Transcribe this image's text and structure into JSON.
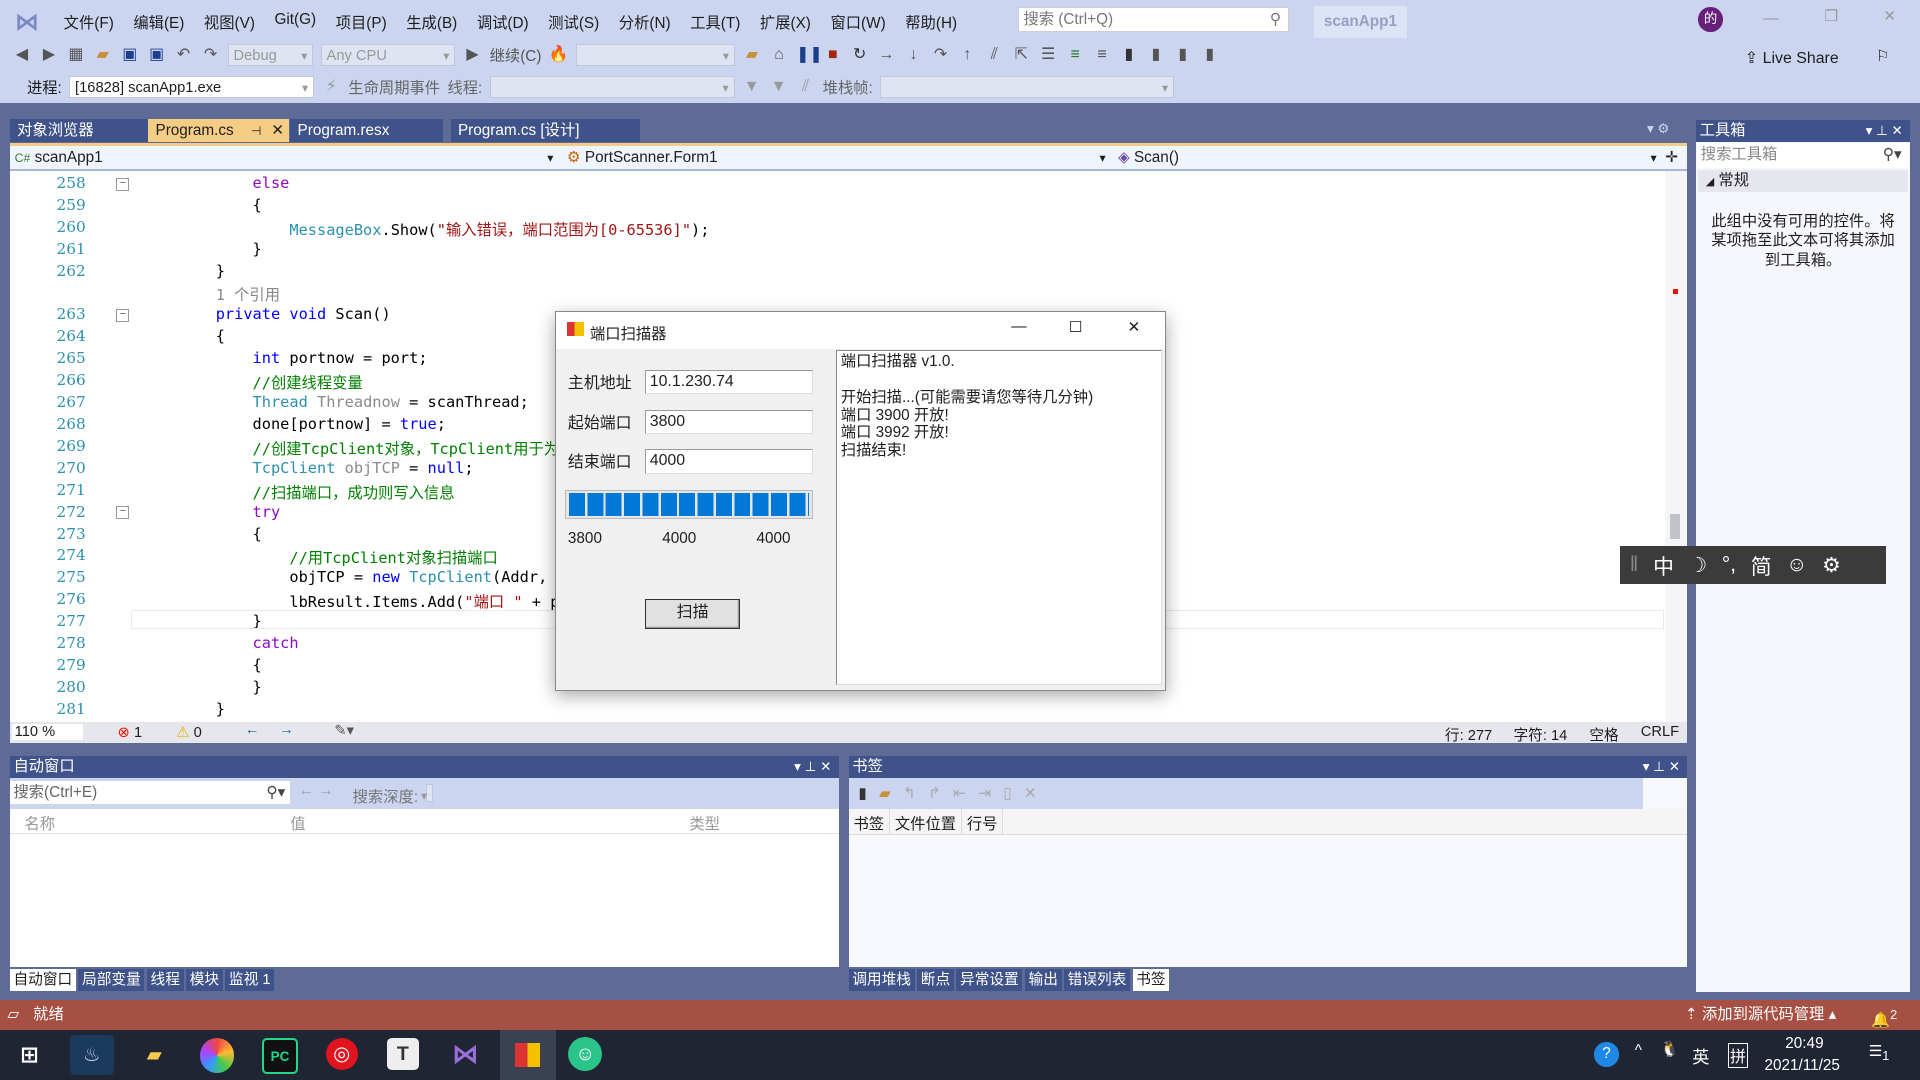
{
  "menu": {
    "items": [
      "文件(F)",
      "编辑(E)",
      "视图(V)",
      "Git(G)",
      "项目(P)",
      "生成(B)",
      "调试(D)",
      "测试(S)",
      "分析(N)",
      "工具(T)",
      "扩展(X)",
      "窗口(W)",
      "帮助(H)"
    ],
    "search_placeholder": "搜索 (Ctrl+Q)",
    "solution": "scanApp1",
    "avatar": "的",
    "live_share": "Live Share"
  },
  "toolbar": {
    "config": "Debug",
    "platform": "Any CPU",
    "continue": "继续(C)",
    "process_label": "进程:",
    "process": "[16828] scanApp1.exe",
    "lifecycle": "生命周期事件",
    "thread_label": "线程:",
    "stack_label": "堆栈帧:"
  },
  "tabs": [
    {
      "label": "对象浏览器"
    },
    {
      "label": "Program.cs",
      "active": true
    },
    {
      "label": "Program.resx"
    },
    {
      "label": "Program.cs [设计]"
    }
  ],
  "nav": {
    "project": "scanApp1",
    "class": "PortScanner.Form1",
    "member": "Scan()"
  },
  "code": [
    {
      "n": "258",
      "t": [
        [
          "            ",
          ""
        ],
        [
          "else",
          "kw"
        ]
      ]
    },
    {
      "n": "259",
      "t": [
        [
          "            {",
          "pl"
        ]
      ]
    },
    {
      "n": "260",
      "t": [
        [
          "                ",
          ""
        ],
        [
          "MessageBox",
          "ty"
        ],
        [
          ".Show(",
          "pl"
        ],
        [
          "\"输入错误，端口范围为[0-65536]\"",
          "st"
        ],
        [
          ");",
          "pl"
        ]
      ]
    },
    {
      "n": "261",
      "t": [
        [
          "            }",
          "pl"
        ]
      ]
    },
    {
      "n": "262",
      "t": [
        [
          "        }",
          "pl"
        ]
      ]
    },
    {
      "n": "",
      "t": [
        [
          "        1 个引用",
          "lens"
        ]
      ]
    },
    {
      "n": "263",
      "t": [
        [
          "        ",
          ""
        ],
        [
          "private void",
          "kb"
        ],
        [
          " Scan()",
          "pl"
        ]
      ]
    },
    {
      "n": "264",
      "t": [
        [
          "        {",
          "pl"
        ]
      ]
    },
    {
      "n": "265",
      "t": [
        [
          "            ",
          ""
        ],
        [
          "int",
          "kb"
        ],
        [
          " portnow = port;",
          "pl"
        ]
      ]
    },
    {
      "n": "266",
      "t": [
        [
          "            ",
          ""
        ],
        [
          "//创建线程变量",
          "cm"
        ]
      ]
    },
    {
      "n": "267",
      "t": [
        [
          "            ",
          ""
        ],
        [
          "Thread",
          "ty"
        ],
        [
          " ",
          ""
        ],
        [
          "Threadnow",
          "un"
        ],
        [
          " = scanThread;",
          "pl"
        ]
      ]
    },
    {
      "n": "268",
      "t": [
        [
          "            done[portnow] = ",
          "pl"
        ],
        [
          "true",
          "kb"
        ],
        [
          ";",
          "pl"
        ]
      ]
    },
    {
      "n": "269",
      "t": [
        [
          "            ",
          ""
        ],
        [
          "//创建TcpClient对象，TcpClient用于为",
          "cm"
        ]
      ]
    },
    {
      "n": "270",
      "t": [
        [
          "            ",
          ""
        ],
        [
          "TcpClient",
          "ty"
        ],
        [
          " ",
          ""
        ],
        [
          "objTCP",
          "un"
        ],
        [
          " = ",
          "pl"
        ],
        [
          "null",
          "kb"
        ],
        [
          ";",
          "pl"
        ]
      ]
    },
    {
      "n": "271",
      "t": [
        [
          "            ",
          ""
        ],
        [
          "//扫描端口，成功则写入信息",
          "cm"
        ]
      ]
    },
    {
      "n": "272",
      "t": [
        [
          "            ",
          ""
        ],
        [
          "try",
          "kw"
        ]
      ]
    },
    {
      "n": "273",
      "t": [
        [
          "            {",
          "pl"
        ]
      ]
    },
    {
      "n": "274",
      "t": [
        [
          "                ",
          ""
        ],
        [
          "//用TcpClient对象扫描端口",
          "cm"
        ]
      ]
    },
    {
      "n": "275",
      "t": [
        [
          "                objTCP = ",
          "pl"
        ],
        [
          "new",
          "kb"
        ],
        [
          " ",
          ""
        ],
        [
          "TcpClient",
          "ty"
        ],
        [
          "(Addr, por",
          "pl"
        ]
      ]
    },
    {
      "n": "276",
      "t": [
        [
          "                lbResult.Items.Add(",
          "pl"
        ],
        [
          "\"端口 \"",
          "st"
        ],
        [
          " + por",
          "pl"
        ]
      ]
    },
    {
      "n": "277",
      "t": [
        [
          "            }",
          "pl"
        ]
      ]
    },
    {
      "n": "278",
      "t": [
        [
          "            ",
          ""
        ],
        [
          "catch",
          "kw"
        ]
      ]
    },
    {
      "n": "279",
      "t": [
        [
          "            {",
          "pl"
        ]
      ]
    },
    {
      "n": "280",
      "t": [
        [
          "            }",
          "pl"
        ]
      ]
    },
    {
      "n": "281",
      "t": [
        [
          "        }",
          "pl"
        ]
      ]
    }
  ],
  "editor_status": {
    "zoom": "110 %",
    "errors": "1",
    "warnings": "0",
    "line": "行: 277",
    "char": "字符: 14",
    "spaces": "空格",
    "eol": "CRLF"
  },
  "dialog": {
    "title": "端口扫描器",
    "host_label": "主机地址",
    "host": "10.1.230.74",
    "start_label": "起始端口",
    "start": "3800",
    "end_label": "结束端口",
    "end": "4000",
    "progress": 100,
    "progress_labels": [
      "3800",
      "4000",
      "4000"
    ],
    "scan_button": "扫描",
    "output": [
      "端口扫描器 v1.0.",
      "",
      "开始扫描...(可能需要请您等待几分钟)",
      "端口 3900 开放!",
      "端口 3992 开放!",
      "扫描结束!"
    ]
  },
  "toolbox": {
    "title": "工具箱",
    "search_placeholder": "搜索工具箱",
    "group": "常规",
    "empty": "此组中没有可用的控件。将某项拖至此文本可将其添加到工具箱。"
  },
  "ime": {
    "items": [
      "中",
      "☽",
      "°,",
      "简",
      "☺",
      "⚙"
    ]
  },
  "autos": {
    "title": "自动窗口",
    "search_placeholder": "搜索(Ctrl+E)",
    "depth_label": "搜索深度:",
    "columns": [
      "名称",
      "值",
      "类型"
    ],
    "tabs": [
      {
        "label": "自动窗口",
        "active": true
      },
      {
        "label": "局部变量"
      },
      {
        "label": "线程"
      },
      {
        "label": "模块"
      },
      {
        "label": "监视 1"
      }
    ]
  },
  "bookmarks": {
    "title": "书签",
    "columns": [
      "书签",
      "文件位置",
      "行号"
    ],
    "tabs": [
      {
        "label": "调用堆栈"
      },
      {
        "label": "断点"
      },
      {
        "label": "异常设置"
      },
      {
        "label": "输出"
      },
      {
        "label": "错误列表"
      },
      {
        "label": "书签",
        "active": true
      }
    ]
  },
  "statusbar": {
    "ready": "就绪",
    "source_control": "添加到源代码管理",
    "notifications": "2"
  },
  "taskbar": {
    "lang": "英",
    "ime": "拼",
    "time": "20:49",
    "date": "2021/11/25",
    "notif": "1"
  },
  "colors": {
    "frame": "#5d6b96",
    "menu": "#ccd5f0",
    "active_tab": "#f5cc84",
    "status": "#a64f43",
    "progress": "#0078d7"
  }
}
